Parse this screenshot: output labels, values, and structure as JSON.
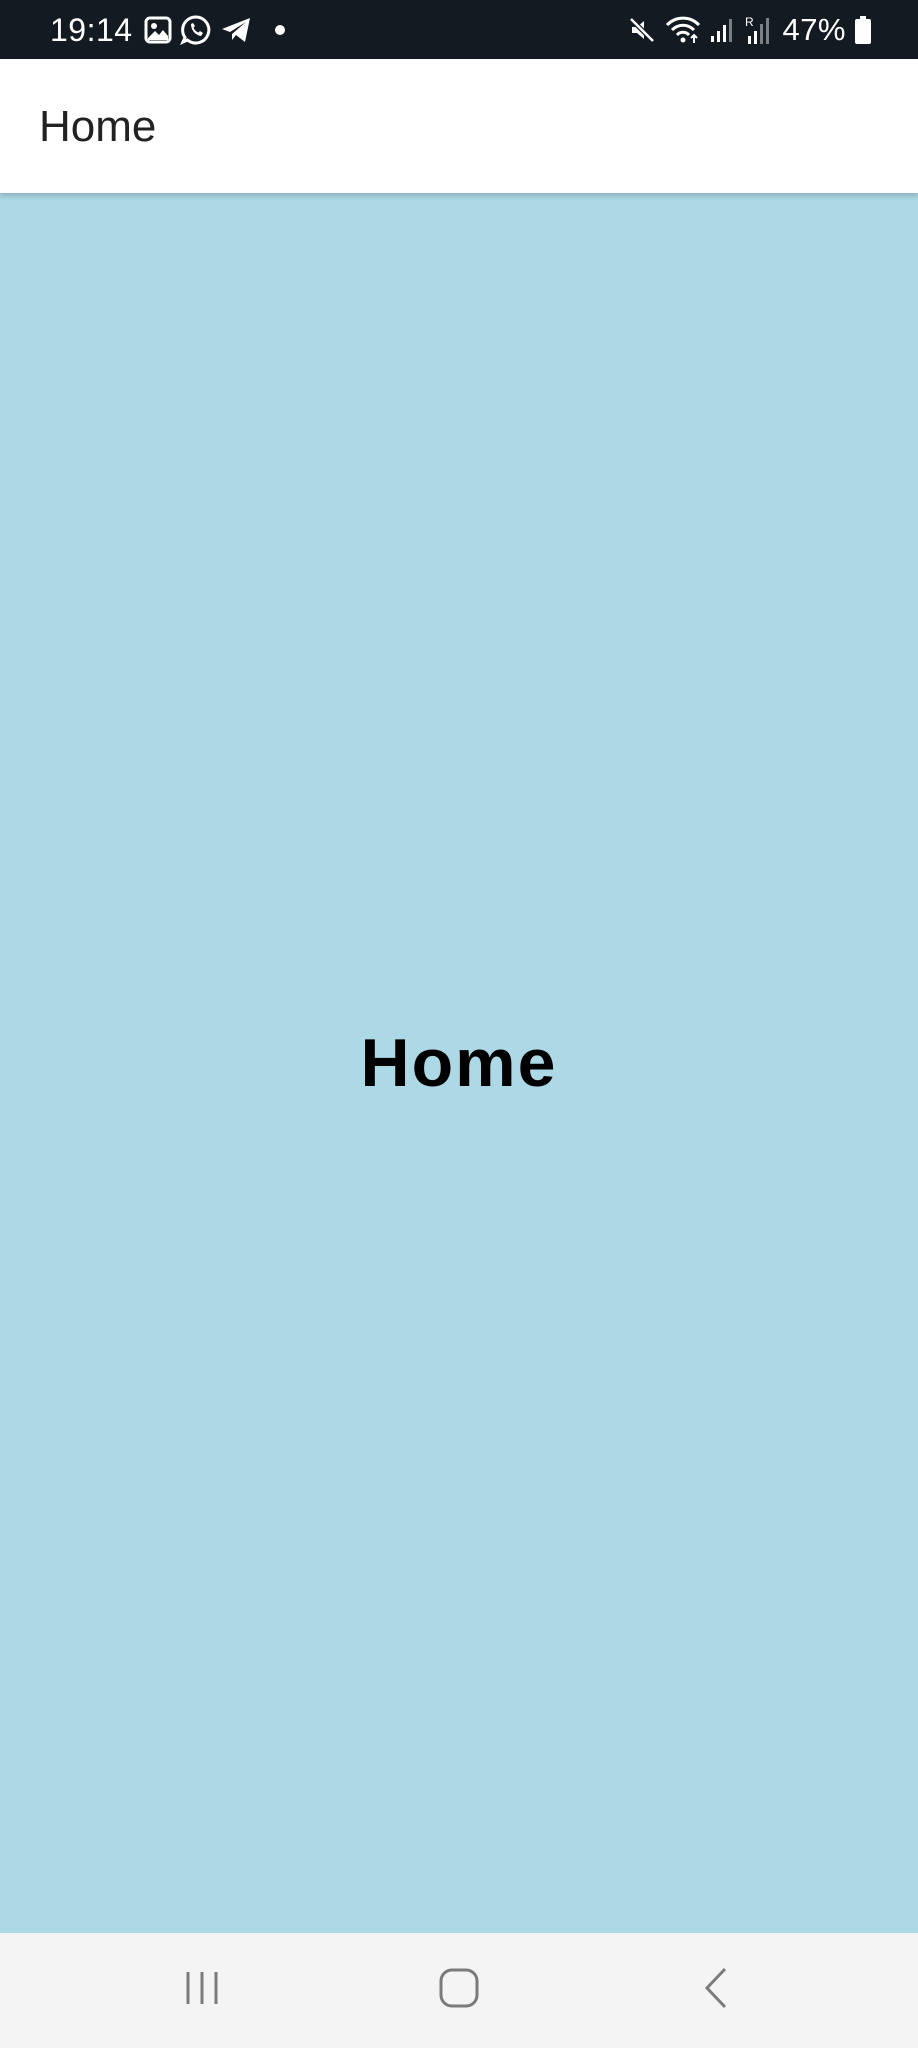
{
  "status_bar": {
    "time": "19:14",
    "battery": "47%",
    "left_icons": [
      "gallery-icon",
      "whatsapp-icon",
      "telegram-icon",
      "dot-icon"
    ],
    "right_icons": [
      "mute-icon",
      "wifi-icon",
      "signal-icon",
      "roaming-signal-icon",
      "battery-icon"
    ]
  },
  "app_bar": {
    "title": "Home"
  },
  "main": {
    "title": "Home",
    "background_color": "#add8e6"
  },
  "nav_bar": {
    "buttons": [
      "recent-apps-icon",
      "home-icon",
      "back-icon"
    ]
  }
}
